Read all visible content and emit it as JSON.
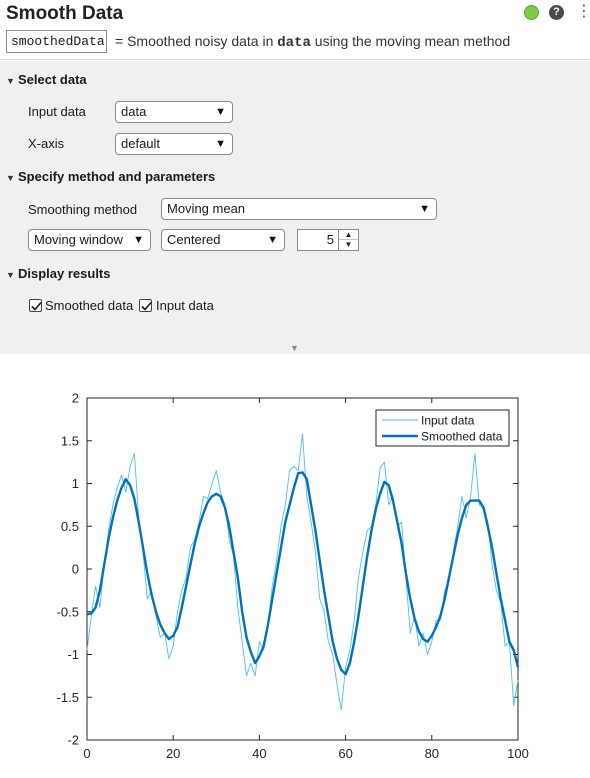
{
  "header": {
    "title": "Smooth Data",
    "output_variable": "smoothedData",
    "desc_prefix": "=  Smoothed noisy data in ",
    "desc_code": "data",
    "desc_suffix": " using the moving mean method",
    "status_color": "#7ec94a",
    "help_icon_glyph": "?",
    "more_icon_glyph": "⋮"
  },
  "select_data": {
    "heading": "Select data",
    "input_label": "Input data",
    "input_value": "data",
    "xaxis_label": "X-axis",
    "xaxis_value": "default"
  },
  "method": {
    "heading": "Specify method and parameters",
    "smoothing_label": "Smoothing method",
    "smoothing_value": "Moving mean",
    "window_type": "Moving window",
    "window_position": "Centered",
    "window_size": "5"
  },
  "display": {
    "heading": "Display results",
    "smoothed_label": "Smoothed data",
    "smoothed_checked": true,
    "input_label": "Input data",
    "input_checked": true
  },
  "chart_data": {
    "type": "line",
    "title": "",
    "xlabel": "",
    "ylabel": "",
    "xlim": [
      0,
      100
    ],
    "ylim": [
      -2,
      2
    ],
    "x_ticks": [
      "0",
      "20",
      "40",
      "60",
      "80",
      "100"
    ],
    "y_ticks": [
      "2",
      "1.5",
      "1",
      "0.5",
      "0",
      "-0.5",
      "-1",
      "-1.5",
      "-2"
    ],
    "legend_position": "top-right",
    "grid": false,
    "series": [
      {
        "name": "Input data",
        "color": "#4dbeee",
        "x": [
          0,
          1,
          2,
          3,
          4,
          5,
          6,
          7,
          8,
          9,
          10,
          11,
          12,
          13,
          14,
          15,
          16,
          17,
          18,
          19,
          20,
          21,
          22,
          23,
          24,
          25,
          26,
          27,
          28,
          29,
          30,
          31,
          32,
          33,
          34,
          35,
          36,
          37,
          38,
          39,
          40,
          41,
          42,
          43,
          44,
          45,
          46,
          47,
          48,
          49,
          50,
          51,
          52,
          53,
          54,
          55,
          56,
          57,
          58,
          59,
          60,
          61,
          62,
          63,
          64,
          65,
          66,
          67,
          68,
          69,
          70,
          71,
          72,
          73,
          74,
          75,
          76,
          77,
          78,
          79,
          80,
          81,
          82,
          83,
          84,
          85,
          86,
          87,
          88,
          89,
          90,
          91,
          92,
          93,
          94,
          95,
          96,
          97,
          98,
          99,
          100
        ],
        "y": [
          -0.95,
          -0.55,
          -0.2,
          -0.45,
          0.05,
          0.45,
          0.75,
          0.95,
          1.1,
          0.9,
          1.2,
          1.35,
          0.6,
          0.2,
          -0.35,
          -0.25,
          -0.55,
          -0.8,
          -0.75,
          -1.05,
          -0.9,
          -0.5,
          -0.25,
          -0.1,
          0.25,
          0.35,
          0.55,
          0.85,
          0.82,
          1.0,
          1.15,
          0.9,
          0.75,
          0.35,
          0.15,
          -0.45,
          -0.85,
          -1.25,
          -1.1,
          -1.25,
          -0.85,
          -0.95,
          -0.65,
          -0.2,
          0.1,
          0.5,
          0.75,
          1.15,
          1.2,
          1.15,
          1.58,
          0.85,
          0.55,
          0.2,
          -0.35,
          -0.5,
          -0.85,
          -1.0,
          -1.35,
          -1.65,
          -1.15,
          -0.95,
          -0.6,
          -0.1,
          0.2,
          0.45,
          0.5,
          0.75,
          1.18,
          1.25,
          0.75,
          0.85,
          0.5,
          0.55,
          -0.1,
          -0.75,
          -0.55,
          -0.9,
          -0.75,
          -1.0,
          -0.85,
          -0.6,
          -0.6,
          -0.25,
          -0.15,
          0.2,
          0.5,
          0.85,
          0.6,
          0.85,
          1.35,
          0.75,
          0.7,
          0.55,
          0.05,
          -0.25,
          -0.4,
          -0.9,
          -0.85,
          -1.6,
          -1.3
        ]
      },
      {
        "name": "Smoothed data",
        "color": "#0072bd",
        "x": [
          0,
          1,
          2,
          3,
          4,
          5,
          6,
          7,
          8,
          9,
          10,
          11,
          12,
          13,
          14,
          15,
          16,
          17,
          18,
          19,
          20,
          21,
          22,
          23,
          24,
          25,
          26,
          27,
          28,
          29,
          30,
          31,
          32,
          33,
          34,
          35,
          36,
          37,
          38,
          39,
          40,
          41,
          42,
          43,
          44,
          45,
          46,
          47,
          48,
          49,
          50,
          51,
          52,
          53,
          54,
          55,
          56,
          57,
          58,
          59,
          60,
          61,
          62,
          63,
          64,
          65,
          66,
          67,
          68,
          69,
          70,
          71,
          72,
          73,
          74,
          75,
          76,
          77,
          78,
          79,
          80,
          81,
          82,
          83,
          84,
          85,
          86,
          87,
          88,
          89,
          90,
          91,
          92,
          93,
          94,
          95,
          96,
          97,
          98,
          99,
          100
        ],
        "y": [
          -0.53,
          -0.52,
          -0.45,
          -0.25,
          0.05,
          0.35,
          0.6,
          0.8,
          0.95,
          1.05,
          0.98,
          0.82,
          0.55,
          0.25,
          -0.05,
          -0.3,
          -0.5,
          -0.65,
          -0.75,
          -0.82,
          -0.78,
          -0.68,
          -0.45,
          -0.2,
          0.05,
          0.3,
          0.5,
          0.65,
          0.78,
          0.85,
          0.88,
          0.85,
          0.72,
          0.5,
          0.2,
          -0.1,
          -0.5,
          -0.8,
          -0.97,
          -1.1,
          -1.02,
          -0.9,
          -0.65,
          -0.35,
          -0.05,
          0.25,
          0.55,
          0.75,
          0.95,
          1.12,
          1.13,
          1.05,
          0.75,
          0.45,
          0.1,
          -0.25,
          -0.55,
          -0.85,
          -1.05,
          -1.18,
          -1.23,
          -1.1,
          -0.85,
          -0.55,
          -0.2,
          0.15,
          0.45,
          0.7,
          0.88,
          1.02,
          0.98,
          0.8,
          0.55,
          0.3,
          -0.05,
          -0.35,
          -0.58,
          -0.73,
          -0.82,
          -0.85,
          -0.78,
          -0.68,
          -0.55,
          -0.35,
          -0.1,
          0.15,
          0.4,
          0.6,
          0.75,
          0.8,
          0.8,
          0.8,
          0.72,
          0.5,
          0.25,
          -0.05,
          -0.35,
          -0.6,
          -0.85,
          -0.95,
          -1.15
        ]
      }
    ]
  }
}
